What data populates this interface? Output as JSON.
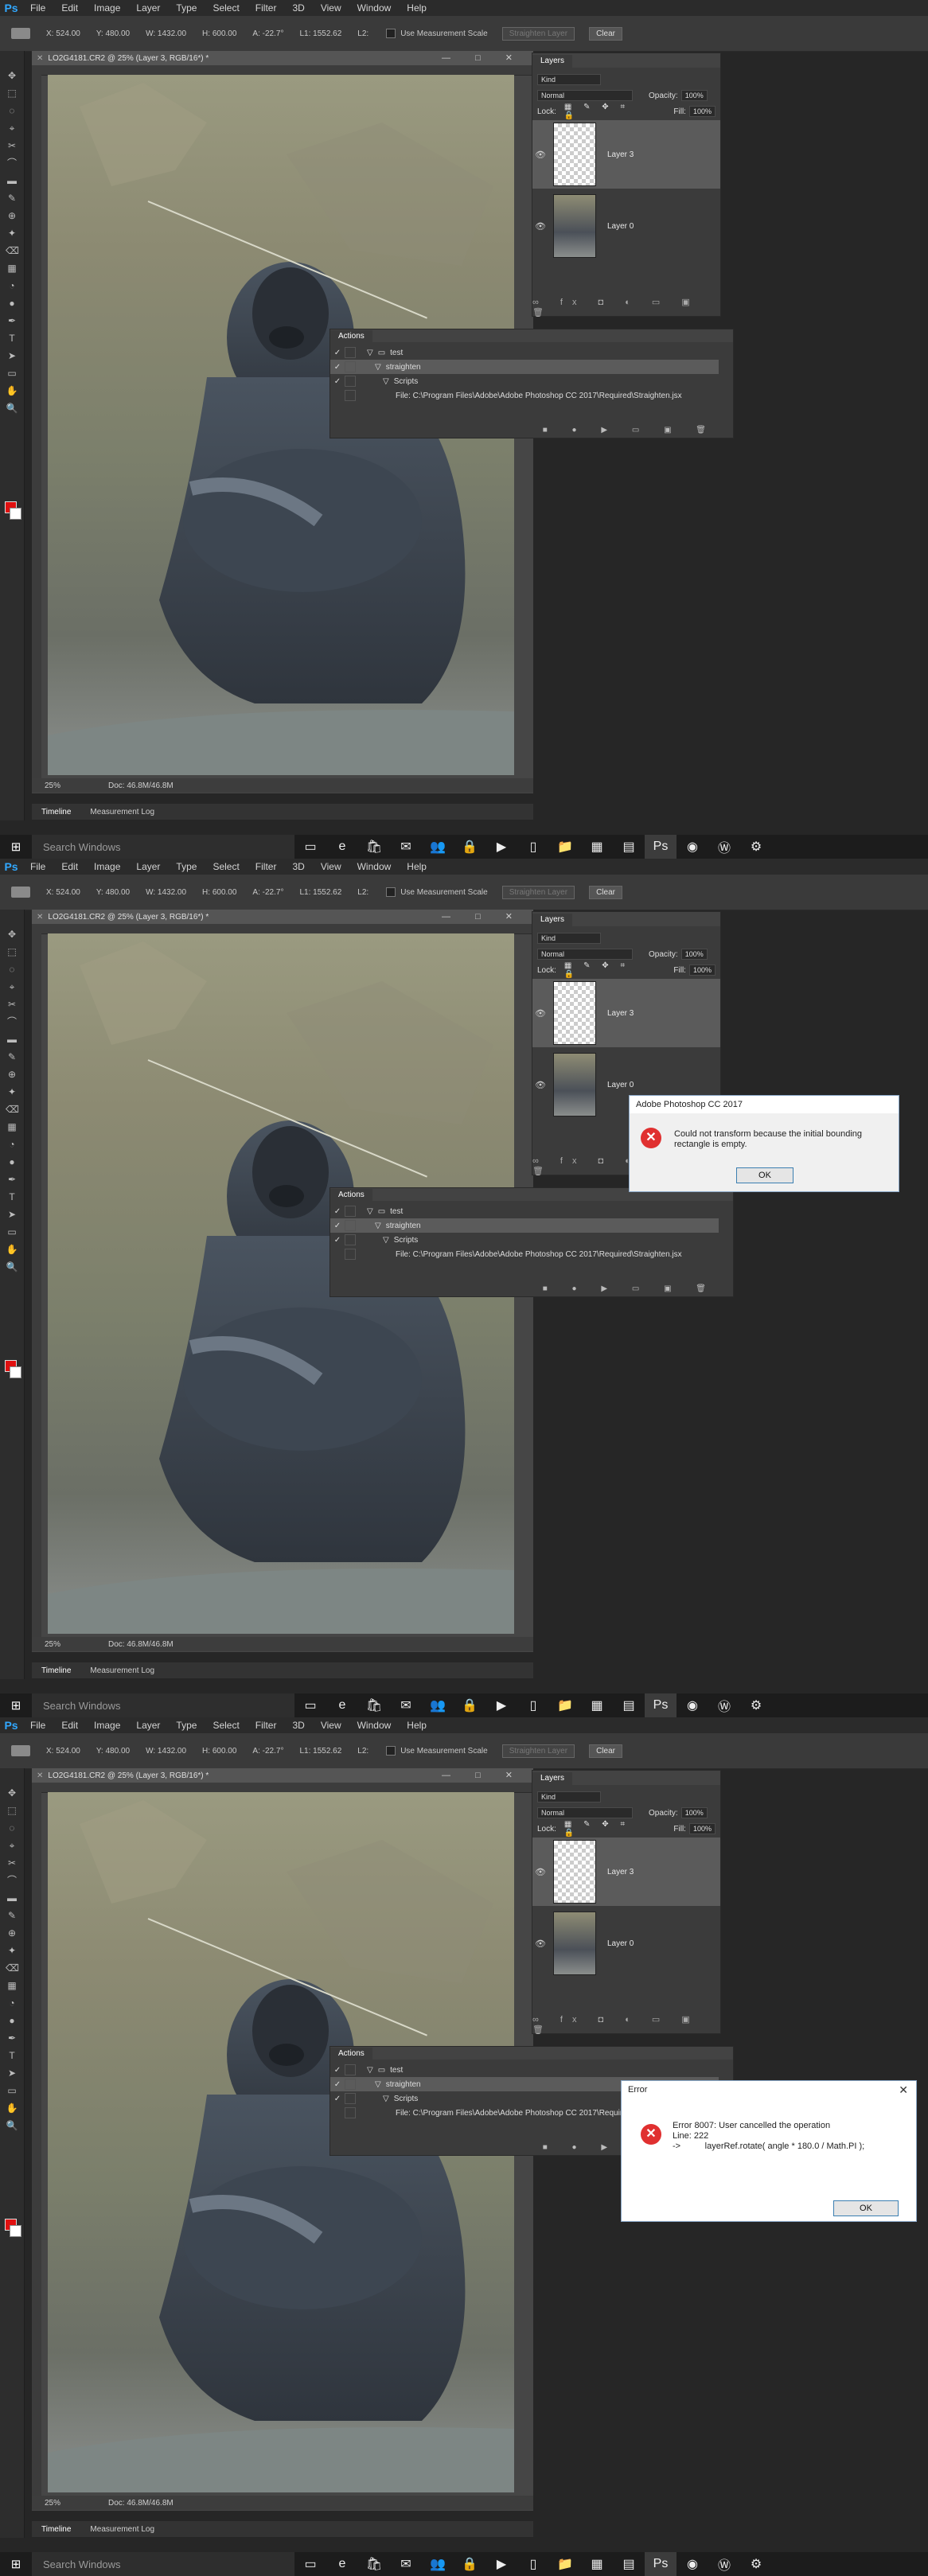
{
  "app": {
    "logo": "Ps"
  },
  "menu": [
    "File",
    "Edit",
    "Image",
    "Layer",
    "Type",
    "Select",
    "Filter",
    "3D",
    "View",
    "Window",
    "Help"
  ],
  "options": {
    "x": "X: 524.00",
    "y": "Y: 480.00",
    "w": "W: 1432.00",
    "h": "H: 600.00",
    "angle": "A: -22.7°",
    "l1": "L1: 1552.62",
    "l2": "L2:",
    "measurement_label": "Use Measurement Scale",
    "straighten_label": "Straighten Layer",
    "clear_label": "Clear"
  },
  "document": {
    "tab_title": "LO2G4181.CR2 @ 25% (Layer 3, RGB/16*) *",
    "zoom": "25%",
    "doc_info": "Doc: 46.8M/46.8M",
    "win_buttons": "— □ ✕"
  },
  "timeline": {
    "tab1": "Timeline",
    "tab2": "Measurement Log"
  },
  "layers": {
    "title": "Layers",
    "kind": "Kind",
    "blend": "Normal",
    "opacity_label": "Opacity:",
    "opacity": "100%",
    "lock_label": "Lock:",
    "fill_label": "Fill:",
    "fill": "100%",
    "items": [
      {
        "name": "Layer 3",
        "selected": true
      },
      {
        "name": "Layer 0",
        "selected": false
      }
    ],
    "footer_icons": "∞ fx ◘ ◐ ▭ ▣ 🗑"
  },
  "actions": {
    "title": "Actions",
    "rows": [
      {
        "label": "test",
        "indent": 1
      },
      {
        "label": "straighten",
        "indent": 2
      },
      {
        "label": "Scripts",
        "indent": 3
      },
      {
        "label": "File: C:\\Program Files\\Adobe\\Adobe Photoshop CC 2017\\Required\\Straighten.jsx",
        "indent": 4
      }
    ],
    "footer_icons": "■ ● ▶ ▭ ▣ 🗑"
  },
  "taskbar": {
    "search_placeholder": "Search Windows",
    "icons": [
      "task-view-icon",
      "edge-icon",
      "store-icon",
      "mail-icon",
      "people-icon",
      "lock-icon",
      "media-icon",
      "terminal-icon",
      "folder-icon",
      "calculator-icon",
      "files-icon",
      "photoshop-icon",
      "chrome-icon",
      "browser-icon",
      "settings-icon"
    ]
  },
  "dialog1": {
    "title": "Adobe Photoshop CC 2017",
    "message": "Could not transform because the initial bounding\nrectangle is empty.",
    "ok": "OK"
  },
  "dialog2": {
    "title": "Error",
    "message": "Error 8007: User cancelled the operation\nLine: 222\n->          layerRef.rotate( angle * 180.0 / Math.PI );",
    "ok": "OK"
  },
  "colors": {
    "accent": "#31a8ff",
    "error": "#e03030",
    "foreground": "#e01010"
  }
}
